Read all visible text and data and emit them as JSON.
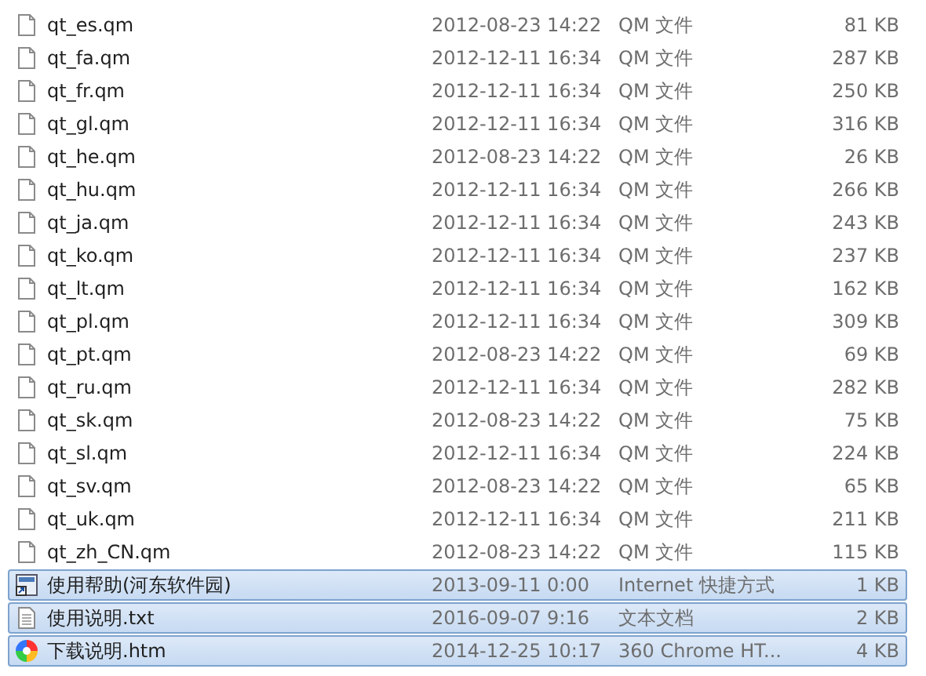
{
  "files": [
    {
      "name": "qt_es.qm",
      "date": "2012-08-23 14:22",
      "type": "QM 文件",
      "size": "81 KB",
      "kind": "document",
      "selected": false
    },
    {
      "name": "qt_fa.qm",
      "date": "2012-12-11 16:34",
      "type": "QM 文件",
      "size": "287 KB",
      "kind": "document",
      "selected": false
    },
    {
      "name": "qt_fr.qm",
      "date": "2012-12-11 16:34",
      "type": "QM 文件",
      "size": "250 KB",
      "kind": "document",
      "selected": false
    },
    {
      "name": "qt_gl.qm",
      "date": "2012-12-11 16:34",
      "type": "QM 文件",
      "size": "316 KB",
      "kind": "document",
      "selected": false
    },
    {
      "name": "qt_he.qm",
      "date": "2012-08-23 14:22",
      "type": "QM 文件",
      "size": "26 KB",
      "kind": "document",
      "selected": false
    },
    {
      "name": "qt_hu.qm",
      "date": "2012-12-11 16:34",
      "type": "QM 文件",
      "size": "266 KB",
      "kind": "document",
      "selected": false
    },
    {
      "name": "qt_ja.qm",
      "date": "2012-12-11 16:34",
      "type": "QM 文件",
      "size": "243 KB",
      "kind": "document",
      "selected": false
    },
    {
      "name": "qt_ko.qm",
      "date": "2012-12-11 16:34",
      "type": "QM 文件",
      "size": "237 KB",
      "kind": "document",
      "selected": false
    },
    {
      "name": "qt_lt.qm",
      "date": "2012-12-11 16:34",
      "type": "QM 文件",
      "size": "162 KB",
      "kind": "document",
      "selected": false
    },
    {
      "name": "qt_pl.qm",
      "date": "2012-12-11 16:34",
      "type": "QM 文件",
      "size": "309 KB",
      "kind": "document",
      "selected": false
    },
    {
      "name": "qt_pt.qm",
      "date": "2012-08-23 14:22",
      "type": "QM 文件",
      "size": "69 KB",
      "kind": "document",
      "selected": false
    },
    {
      "name": "qt_ru.qm",
      "date": "2012-12-11 16:34",
      "type": "QM 文件",
      "size": "282 KB",
      "kind": "document",
      "selected": false
    },
    {
      "name": "qt_sk.qm",
      "date": "2012-08-23 14:22",
      "type": "QM 文件",
      "size": "75 KB",
      "kind": "document",
      "selected": false
    },
    {
      "name": "qt_sl.qm",
      "date": "2012-12-11 16:34",
      "type": "QM 文件",
      "size": "224 KB",
      "kind": "document",
      "selected": false
    },
    {
      "name": "qt_sv.qm",
      "date": "2012-08-23 14:22",
      "type": "QM 文件",
      "size": "65 KB",
      "kind": "document",
      "selected": false
    },
    {
      "name": "qt_uk.qm",
      "date": "2012-12-11 16:34",
      "type": "QM 文件",
      "size": "211 KB",
      "kind": "document",
      "selected": false
    },
    {
      "name": "qt_zh_CN.qm",
      "date": "2012-08-23 14:22",
      "type": "QM 文件",
      "size": "115 KB",
      "kind": "document",
      "selected": false
    },
    {
      "name": "使用帮助(河东软件园)",
      "date": "2013-09-11 0:00",
      "type": "Internet 快捷方式",
      "size": "1 KB",
      "kind": "shortcut",
      "selected": true
    },
    {
      "name": "使用说明.txt",
      "date": "2016-09-07 9:16",
      "type": "文本文档",
      "size": "2 KB",
      "kind": "text",
      "selected": true
    },
    {
      "name": "下载说明.htm",
      "date": "2014-12-25 10:17",
      "type": "360 Chrome HT...",
      "size": "4 KB",
      "kind": "web",
      "selected": true
    }
  ]
}
